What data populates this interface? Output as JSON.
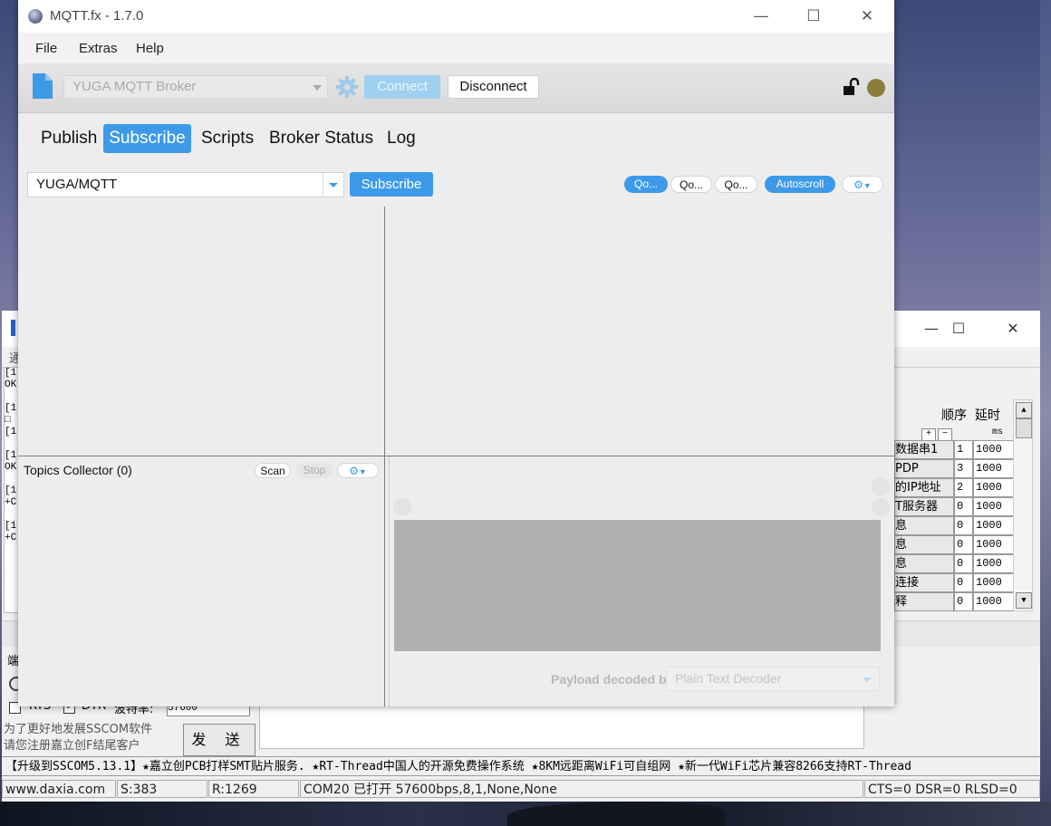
{
  "mqtt": {
    "title": "MQTT.fx - 1.7.0",
    "menu": [
      "File",
      "Extras",
      "Help"
    ],
    "broker_profile": "YUGA MQTT Broker",
    "connect_label": "Connect",
    "disconnect_label": "Disconnect",
    "tabs": [
      "Publish",
      "Subscribe",
      "Scripts",
      "Broker Status",
      "Log"
    ],
    "active_tab": "Subscribe",
    "topic_value": "YUGA/MQTT",
    "subscribe_label": "Subscribe",
    "qos_buttons": [
      "Qo...",
      "Qo...",
      "Qo..."
    ],
    "autoscroll_label": "Autoscroll",
    "topics_collector_label": "Topics Collector (0)",
    "scan_label": "Scan",
    "stop_label": "Stop",
    "payload_decoded_label": "Payload decoded by",
    "decoder_value": "Plain Text Decoder",
    "colors": {
      "accent": "#3c9ae8",
      "connect_disabled": "#9fd0f0",
      "status_dot": "#8b7d3a",
      "payload_area": "#b0b0b0"
    }
  },
  "sscom": {
    "table_header_order": "顺序",
    "table_header_delay": "延时",
    "unit_ms": "ms",
    "plus": "+",
    "minus": "−",
    "rows": [
      {
        "name": "数据串1",
        "order": "1",
        "delay": "1000"
      },
      {
        "name": "PDP",
        "order": "3",
        "delay": "1000"
      },
      {
        "name": "的IP地址",
        "order": "2",
        "delay": "1000"
      },
      {
        "name": "T服务器",
        "order": "0",
        "delay": "1000"
      },
      {
        "name": "息",
        "order": "0",
        "delay": "1000"
      },
      {
        "name": "息",
        "order": "0",
        "delay": "1000"
      },
      {
        "name": "息",
        "order": "0",
        "delay": "1000"
      },
      {
        "name": "连接",
        "order": "0",
        "delay": "1000"
      },
      {
        "name": "释",
        "order": "0",
        "delay": "1000"
      }
    ],
    "log_fragments": [
      "[1",
      "OK",
      "",
      "[1",
      "□",
      "[1",
      "",
      "[1",
      "OK",
      "",
      "[1",
      "+C",
      "",
      "[1",
      "+C"
    ],
    "rts_label": "RTS",
    "dtr_label": "DTR",
    "baud_label": "波特率:",
    "baud_value": "57600",
    "promo_line1": "为了更好地发展SSCOM软件",
    "promo_line2": "请您注册嘉立创F结尾客户",
    "send_label": "发 送",
    "ticker": "【升级到SSCOM5.13.1】★嘉立创PCB打样SMT贴片服务. ★RT-Thread中国人的开源免费操作系统 ★8KM远距离WiFi可自组网 ★新一代WiFi芯片兼容8266支持RT-Thread",
    "status": {
      "site": "www.daxia.com",
      "sent": "S:383",
      "received": "R:1269",
      "port": "COM20 已打开  57600bps,8,1,None,None",
      "signals": "CTS=0 DSR=0 RLSD=0"
    }
  }
}
